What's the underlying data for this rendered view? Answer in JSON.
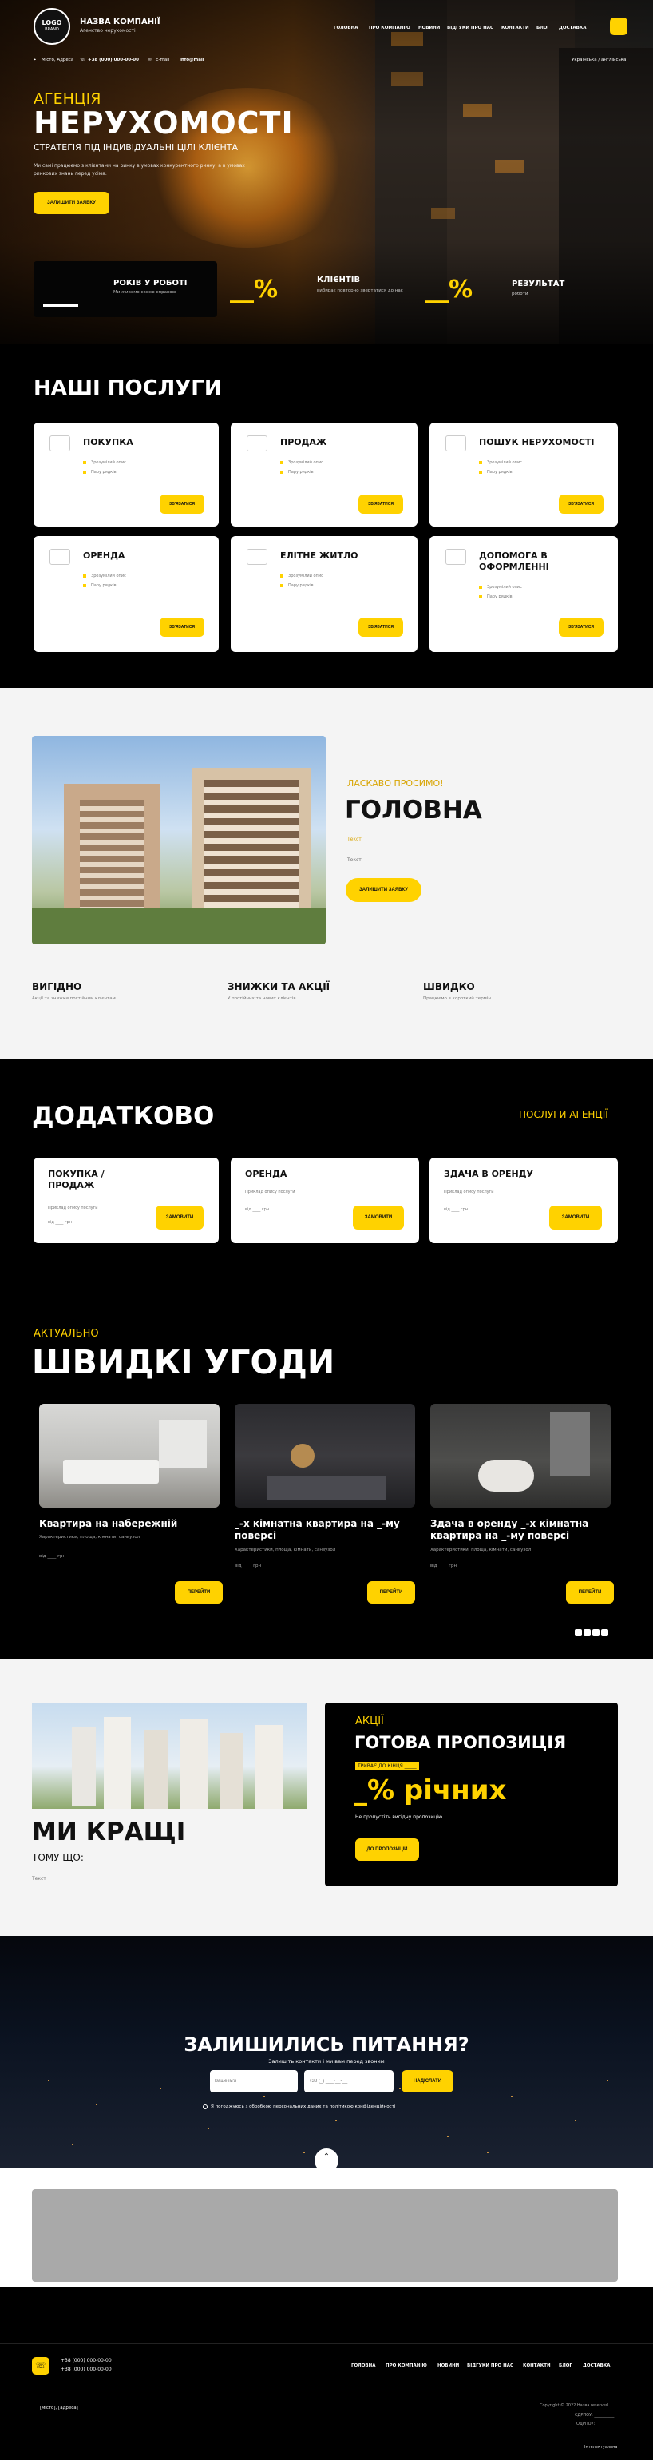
{
  "header": {
    "logo_main": "LOGO",
    "logo_sub": "BRAND",
    "company": "НАЗВА КОМПАНІЇ",
    "company_sub": "Агенство нерухомості",
    "nav": [
      "ГОЛОВНА",
      "ПРО КОМПАНІЮ",
      "НОВИНИ",
      "ВІДГУКИ ПРО НАС",
      "КОНТАКТИ",
      "БЛОГ",
      "ДОСТАВКА"
    ],
    "address": "Місто, Адреса",
    "phone": "+38 (000) 000-00-00",
    "email_label": "E-mail",
    "email": "info@mail",
    "lang": "Українська / англійська"
  },
  "hero": {
    "kicker": "АГЕНЦІЯ",
    "title": "НЕРУХОМОСТІ",
    "subtitle": "СТРАТЕГІЯ ПІД ІНДИВІДУАЛЬНІ ЦІЛІ КЛІЄНТА",
    "desc": "Ми самі працюємо з клієнтами на ринку в умовах конкурентного ринку, а в умовах ринкових знань перед усіма.",
    "cta": "ЗАЛИШИТИ ЗАЯВКУ",
    "stat1_title": "РОКІВ У РОБОТІ",
    "stat1_sub": "Ми живемо своєю справою",
    "stat2_num": "__%",
    "stat2_title": "КЛІЄНТІВ",
    "stat2_sub": "вибирає повторно звертатися до нас",
    "stat3_num": "__%",
    "stat3_title": "РЕЗУЛЬТАТ",
    "stat3_sub": "роботи"
  },
  "services": {
    "title": "НАШІ ПОСЛУГИ",
    "bullet1": "Зрозумілий опис",
    "bullet2": "Пару рядків",
    "btn": "ЗВ'ЯЗАТИСЯ",
    "items": [
      "ПОКУПКА",
      "ПРОДАЖ",
      "ПОШУК НЕРУХОМОСТІ",
      "ОРЕНДА",
      "ЕЛІТНЕ ЖИТЛО",
      "ДОПОМОГА В ОФОРМЛЕННІ"
    ]
  },
  "about": {
    "kicker": "ЛАСКАВО ПРОСИМО!",
    "title": "ГОЛОВНА",
    "text1": "Текст",
    "text2": "Текст",
    "cta": "ЗАЛИШИТИ ЗАЯВКУ",
    "f1_title": "ВИГІДНО",
    "f1_sub": "Акції та знижки постійним клієнтам",
    "f2_title": "ЗНИЖКИ ТА АКЦІЇ",
    "f2_sub": "У постійних та нових клієнтів",
    "f3_title": "ШВИДКО",
    "f3_sub": "Працюємо в короткий термін"
  },
  "extra": {
    "title": "ДОДАТКОВО",
    "link": "ПОСЛУГИ АГЕНЦІЇ",
    "btn": "ЗАМОВИТИ",
    "sub": "Приклад опису послуги",
    "price": "від ____ грн",
    "items": [
      "ПОКУПКА / ПРОДАЖ",
      "ОРЕНДА",
      "ЗДАЧА В ОРЕНДУ"
    ]
  },
  "deals": {
    "kicker": "АКТУАЛЬНО",
    "title": "ШВИДКІ УГОДИ",
    "desc": "Характеристики, площа, кімнати, санвузол",
    "price": "від ____ грн",
    "btn": "ПЕРЕЙТИ",
    "items": [
      "Квартира на набережній",
      "_-х кімнатна квартира на _-му поверсі",
      "Здача в оренду _-х кімнатна квартира на _-му поверсі"
    ]
  },
  "best": {
    "title": "МИ КРАЩІ",
    "sub": "ТОМУ ЩО:",
    "text": "Текст",
    "promo_kicker": "АКЦІЇ",
    "promo_title": "ГОТОВА ПРОПОЗИЦІЯ",
    "promo_timer": "ТРИВАЄ ДО КІНЦЯ _____",
    "promo_big": "_% річних",
    "promo_sub": "Не пропустіть вигідну пропозицію",
    "promo_btn": "ДО ПРОПОЗИЦІЙ"
  },
  "ask": {
    "title": "ЗАЛИШИЛИСЬ ПИТАННЯ?",
    "sub": "Залишіть контакти і ми вам перед звоним",
    "name_ph": "Ваше ім'я",
    "phone_ph": "+38 (_) ___-__-__",
    "btn": "НАДІСЛАТИ",
    "consent": "Я погоджуюсь з обробкою персональних даних та політикою конфіденційності"
  },
  "footer": {
    "phone1": "+38 (000) 000-00-00",
    "phone2": "+38 (000) 000-00-00",
    "nav": [
      "ГОЛОВНА",
      "ПРО КОМПАНІЮ",
      "НОВИНИ",
      "ВІДГУКИ ПРО НАС",
      "КОНТАКТИ",
      "БЛОГ",
      "ДОСТАВКА"
    ],
    "legal": "[місто], [адреса]",
    "copyright": "Copyright © 2022 Назва reserved",
    "line2": "ЄДРПОУ: __________",
    "line3": "ОДРПОУ: __________",
    "made": "Інтелектуальна"
  }
}
